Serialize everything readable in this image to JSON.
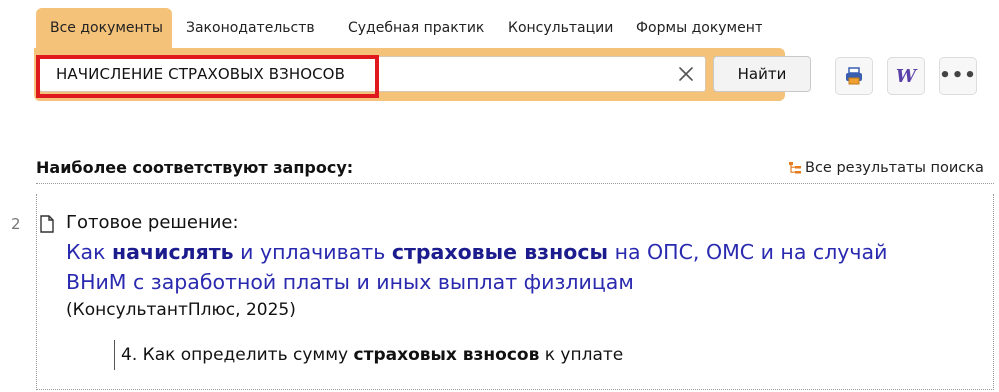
{
  "tabs": [
    {
      "label": "Все документы",
      "active": true
    },
    {
      "label": "Законодательств",
      "active": false
    },
    {
      "label": "Судебная практик",
      "active": false
    },
    {
      "label": "Консультации",
      "active": false
    },
    {
      "label": "Формы документ",
      "active": false
    }
  ],
  "search": {
    "value": "НАЧИСЛЕНИЕ СТРАХОВЫХ ВЗНОСОВ",
    "find_label": "Найти",
    "clear_icon": "close-icon"
  },
  "toolbar": {
    "print_icon": "printer-icon",
    "word_icon": "word-icon",
    "word_glyph": "W",
    "more_icon": "more-icon",
    "more_glyph": "•••"
  },
  "results": {
    "header": "Наиболее соответствуют запросу:",
    "all_results_label": "Все результаты поиска",
    "items": [
      {
        "number": "2",
        "kind": "Готовое решение:",
        "title_parts": {
          "p1": "Как ",
          "b1": "начислять",
          "p2": " и уплачивать ",
          "b2": "страховые взносы",
          "p3": " на ОПС, ОМС и на случай ВНиМ с заработной платы и иных выплат физлицам"
        },
        "source": "(КонсультантПлюс, 2025)",
        "fragment_parts": {
          "p1": "4. Как определить сумму ",
          "b1": "страховых взносов",
          "p2": " к уплате"
        }
      }
    ]
  },
  "colors": {
    "accent": "#f5c27a",
    "link": "#2a2ab0",
    "highlight": "#e0191f",
    "all_results_icon": "#e57c1f"
  }
}
